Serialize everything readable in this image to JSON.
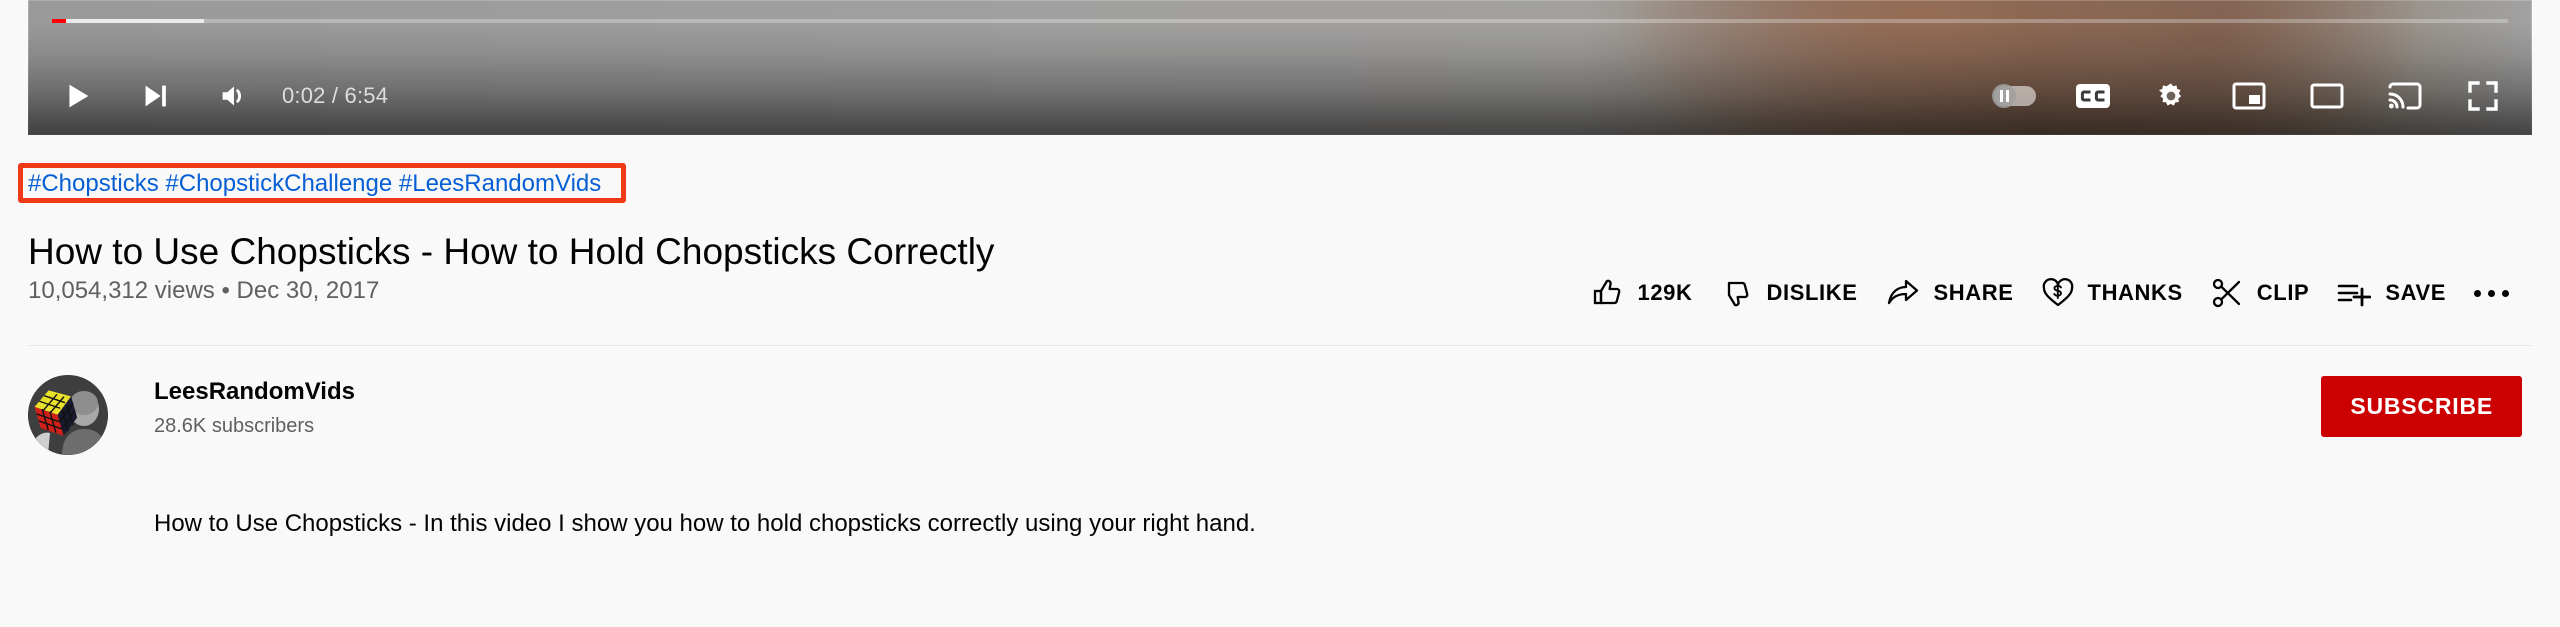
{
  "player": {
    "progress": {
      "played_percent": 0.55,
      "loaded_percent": 6.2
    },
    "time_display": "0:02 / 6:54",
    "current_time": "0:02",
    "duration": "6:54",
    "left_controls": [
      {
        "name": "play-button",
        "icon": "play-icon",
        "label": "Play"
      },
      {
        "name": "next-video-button",
        "icon": "next-icon",
        "label": "Next"
      },
      {
        "name": "volume-button",
        "icon": "volume-icon",
        "label": "Mute"
      }
    ],
    "right_controls": [
      {
        "name": "autoplay-toggle",
        "icon": "autoplay-toggle-icon",
        "label": "Autoplay is off",
        "state": "off"
      },
      {
        "name": "subtitles-button",
        "icon": "closed-captions-icon",
        "label": "Subtitles/closed captions"
      },
      {
        "name": "settings-button",
        "icon": "gear-icon",
        "label": "Settings"
      },
      {
        "name": "miniplayer-button",
        "icon": "miniplayer-icon",
        "label": "Miniplayer"
      },
      {
        "name": "theater-mode-button",
        "icon": "theater-mode-icon",
        "label": "Theater mode"
      },
      {
        "name": "cast-button",
        "icon": "cast-icon",
        "label": "Play on TV"
      },
      {
        "name": "fullscreen-button",
        "icon": "fullscreen-icon",
        "label": "Full screen"
      }
    ]
  },
  "video": {
    "hashtags": [
      {
        "label": "#Chopsticks"
      },
      {
        "label": "#ChopstickChallenge"
      },
      {
        "label": "#LeesRandomVids"
      }
    ],
    "hashtags_text": "#Chopsticks #ChopstickChallenge #LeesRandomVids",
    "title": "How to Use Chopsticks - How to Hold Chopsticks Correctly",
    "views": "10,054,312 views",
    "publish_date": "Dec 30, 2017",
    "view_info": "10,054,312 views • Dec 30, 2017",
    "description": "How to Use Chopsticks - In this video I show you how to hold chopsticks correctly using your right hand."
  },
  "actions": [
    {
      "name": "like-button",
      "icon": "thumbs-up-icon",
      "label": "129K"
    },
    {
      "name": "dislike-button",
      "icon": "thumbs-down-icon",
      "label": "DISLIKE"
    },
    {
      "name": "share-button",
      "icon": "share-arrow-icon",
      "label": "SHARE"
    },
    {
      "name": "thanks-button",
      "icon": "heart-dollar-icon",
      "label": "THANKS"
    },
    {
      "name": "clip-button",
      "icon": "scissors-icon",
      "label": "CLIP"
    },
    {
      "name": "save-button",
      "icon": "save-playlist-icon",
      "label": "SAVE"
    }
  ],
  "channel": {
    "name": "LeesRandomVids",
    "subscribers": "28.6K subscribers",
    "subscribe_label": "SUBSCRIBE"
  },
  "annotation": {
    "target": "hashtags",
    "color": "#f03a17"
  },
  "colors": {
    "page_background": "#f9f9f9",
    "link_blue": "#065fd4",
    "subscribe_red": "#cc0000",
    "progress_red": "#ff0000",
    "secondary_text": "#606060",
    "primary_text": "#030303",
    "divider": "#e5e5e5",
    "annotation_red": "#f03a17"
  }
}
